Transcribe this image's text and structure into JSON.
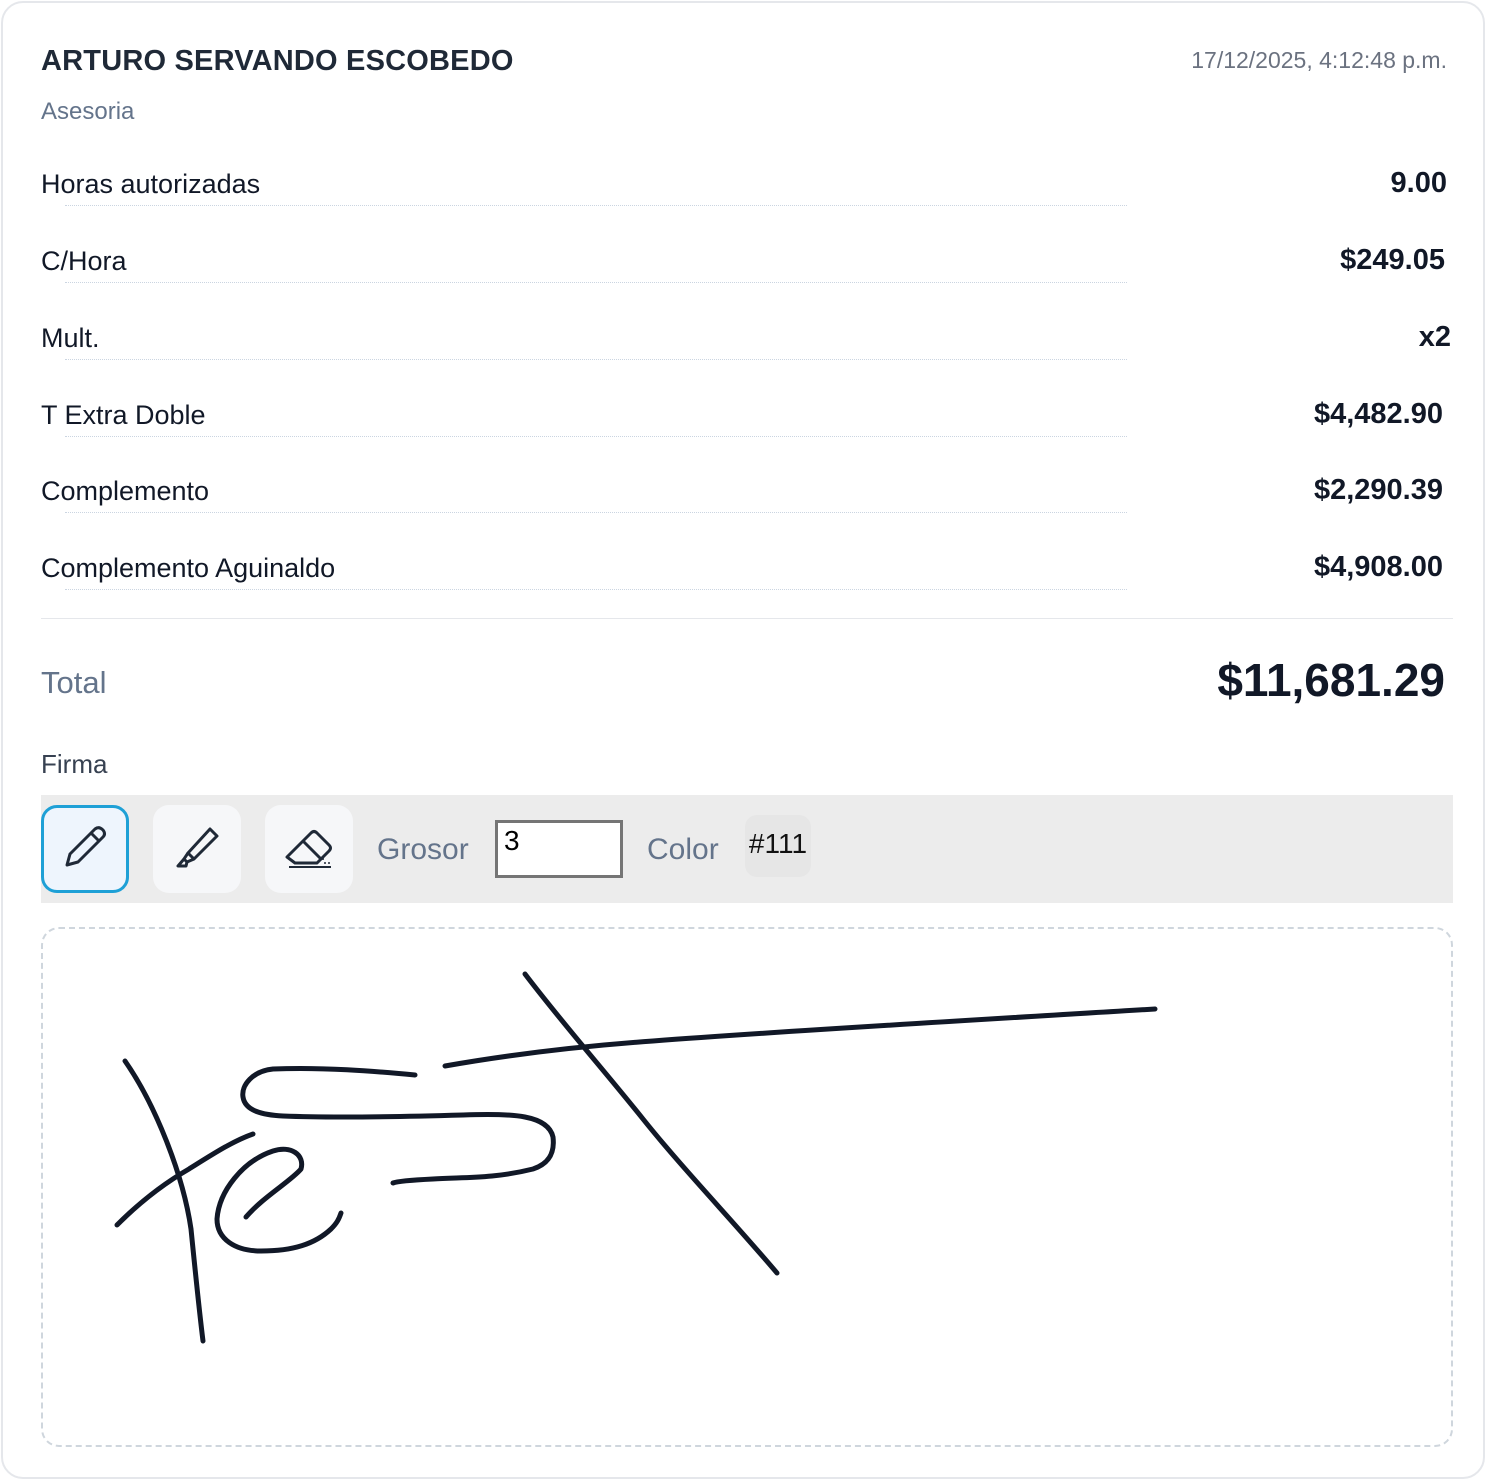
{
  "header": {
    "name": "ARTURO SERVANDO ESCOBEDO",
    "timestamp": "17/12/2025, 4:12:48 p.m.",
    "subtitle": "Asesoria"
  },
  "rows": [
    {
      "label": "Horas autorizadas",
      "value": "9.00"
    },
    {
      "label": "C/Hora",
      "value": "$249.05"
    },
    {
      "label": "Mult.",
      "value": "x2"
    },
    {
      "label": "T Extra Doble",
      "value": "$4,482.90"
    },
    {
      "label": "Complemento",
      "value": "$2,290.39"
    },
    {
      "label": "Complemento Aguinaldo",
      "value": "$4,908.00"
    }
  ],
  "total": {
    "label": "Total",
    "value": "$11,681.29"
  },
  "signature": {
    "label": "Firma",
    "tools": [
      {
        "icon": "pen-icon",
        "active": true
      },
      {
        "icon": "highlighter-icon",
        "active": false
      },
      {
        "icon": "eraser-icon",
        "active": false
      }
    ],
    "thickness_label": "Grosor",
    "thickness_value": "3",
    "color_label": "Color",
    "color_value": "#111",
    "stroke_color": "#111827"
  }
}
